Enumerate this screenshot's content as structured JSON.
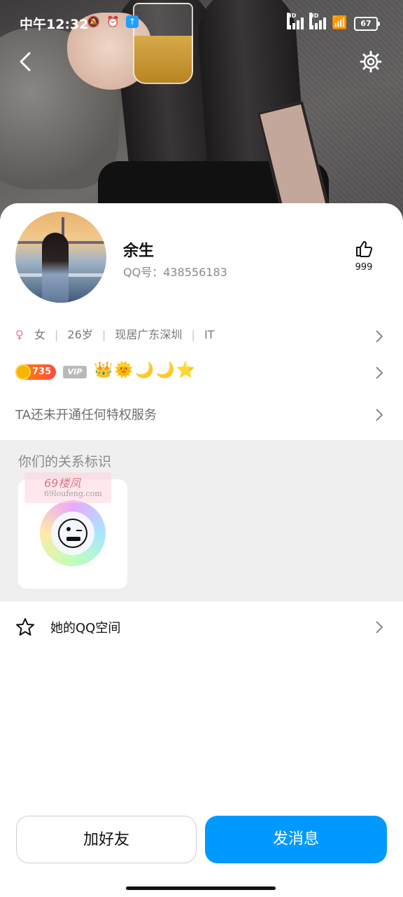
{
  "status_bar": {
    "time": "中午12:32",
    "battery": "67",
    "sim_label": "HD",
    "sim2_label": "HD"
  },
  "profile": {
    "nickname": "余生",
    "qq_label": "QQ号：",
    "qq_number": "438556183",
    "likes": "999"
  },
  "info": {
    "gender": "女",
    "age": "26岁",
    "location": "现居广东深圳",
    "job": "IT"
  },
  "badges": {
    "level": "735",
    "vip": "VIP",
    "level_icons": "👑🌞🌙🌙⭐"
  },
  "privilege": {
    "text": "TA还未开通任何特权服务"
  },
  "relation": {
    "title": "你们的关系标识"
  },
  "watermark": {
    "text": "69楼凤",
    "url": "69loufeng.com"
  },
  "qzone": {
    "label": "她的QQ空间"
  },
  "actions": {
    "add_friend": "加好友",
    "send_message": "发消息"
  },
  "colors": {
    "primary": "#0099ff",
    "gender": "#ef6fa6",
    "level_badge": "#ff4a3d"
  }
}
